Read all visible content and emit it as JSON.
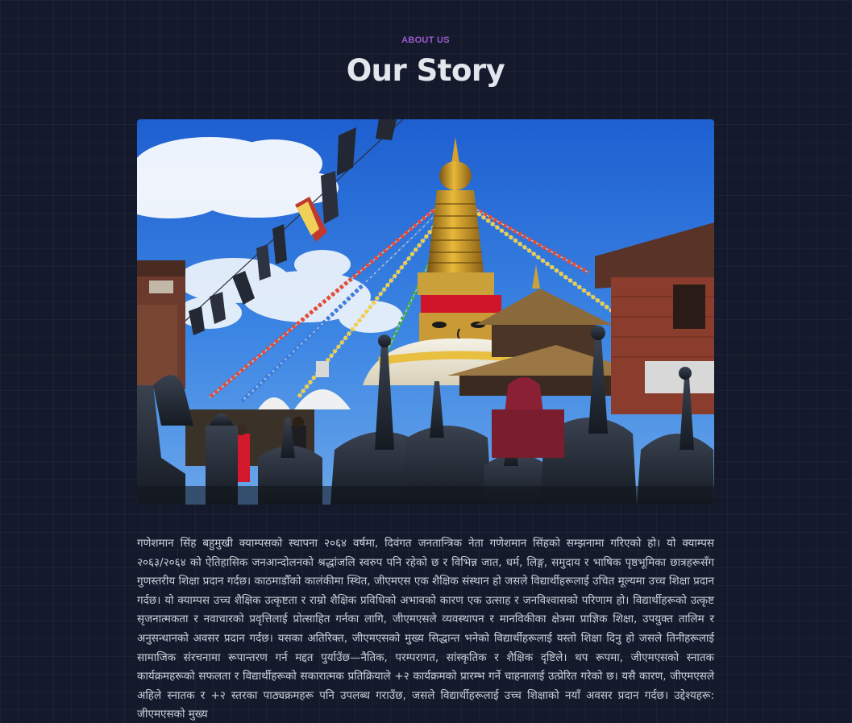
{
  "about": {
    "eyebrow": "ABOUT US",
    "title": "Our Story",
    "image_subject": "Swayambhunath stupa with prayer flags under a blue sky",
    "paragraph": "गणेशमान सिंह बहुमुखी क्याम्पसको स्थापना २०६४ वर्षमा, दिवंगत जनतान्त्रिक नेता गणेशमान सिंहको सम्झनामा गरिएको हो। यो क्याम्पस २०६३/२०६४ को ऐतिहासिक जनआन्दोलनको श्रद्धांजलि स्वरुप पनि रहेको छ र विभिन्न जात, धर्म, लिङ्ग, समुदाय र भाषिक पृष्ठभूमिका छात्रहरूसँग गुणस्तरीय शिक्षा प्रदान गर्दछ। काठमाडौँको कालंकीमा स्थित, जीएमएस एक शैक्षिक संस्थान हो जसले विद्यार्थीहरूलाई उचित मूल्यमा उच्च शिक्षा प्रदान गर्दछ। यो क्याम्पस उच्च शैक्षिक उत्कृष्टता र राम्रो शैक्षिक प्रविधिको अभावको कारण एक उत्साह र जनविश्वासको परिणाम हो। विद्यार्थीहरूको उत्कृष्ट सृजनात्मकता र नवाचारको प्रवृत्तिलाई प्रोत्साहित गर्नका लागि, जीएमएसले व्यवस्थापन र मानविकीका क्षेत्रमा प्राज्ञिक शिक्षा, उपयुक्त तालिम र अनुसन्धानको अवसर प्रदान गर्दछ। यसका अतिरिक्त, जीएमएसको मुख्य सिद्धान्त भनेको विद्यार्थीहरूलाई यस्तो शिक्षा दिनु हो जसले तिनीहरूलाई सामाजिक संरचनामा रूपान्तरण गर्न मद्दत पुर्याउँछ—नैतिक, परम्परागत, सांस्कृतिक र शैक्षिक दृष्टिले। थप रूपमा, जीएमएसको स्नातक कार्यक्रमहरूको सफलता र विद्यार्थीहरूको सकारात्मक प्रतिक्रियाले +२ कार्यक्रमको प्रारम्भ गर्ने चाहनालाई उत्प्रेरित गरेको छ। यसै कारण, जीएमएसले अहिले स्नातक र +२ स्तरका पाठ्यक्रमहरू पनि उपलब्ध गराउँछ, जसले विद्यार्थीहरूलाई उच्च शिक्षाको नयाँ अवसर प्रदान गर्दछ। उद्देश्यहरू: जीएमएसको मुख्य"
  },
  "colors": {
    "background": "#141a2b",
    "accent": "#9b59d0",
    "title": "#e3e6ec",
    "body_text": "#c9ced8"
  }
}
